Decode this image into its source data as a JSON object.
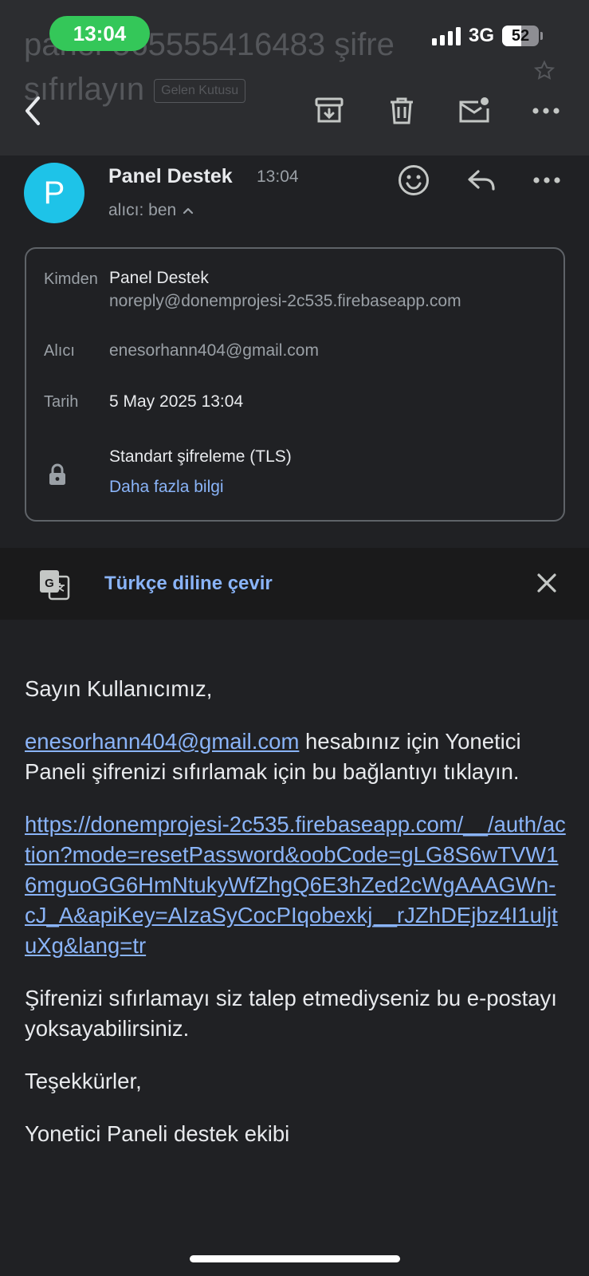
{
  "status": {
    "time": "13:04",
    "network": "3G",
    "battery": "52",
    "battery_level": 0.52
  },
  "header": {
    "subject_line1": "panel-565555416483 şifre",
    "subject_line2": "sıfırlayın",
    "label": "Gelen Kutusu"
  },
  "email": {
    "avatar_letter": "P",
    "sender_name": "Panel Destek",
    "time": "13:04",
    "to_line": "alıcı: ben"
  },
  "details": {
    "from_label": "Kimden",
    "from_name": "Panel Destek",
    "from_email": "noreply@donemprojesi-2c535.firebaseapp.com",
    "to_label": "Alıcı",
    "to_email": "enesorhann404@gmail.com",
    "date_label": "Tarih",
    "date_value": "5 May 2025 13:04",
    "encryption": "Standart şifreleme (TLS)",
    "more_info": "Daha fazla bilgi"
  },
  "translate": {
    "label": "Türkçe diline çevir"
  },
  "body": {
    "greeting": "Sayın Kullanıcımız,",
    "account_link": "enesorhann404@gmail.com",
    "intro_rest": " hesabınız için Yonetici Paneli şifrenizi sıfırlamak için bu bağlantıyı tıklayın.",
    "reset_link": "https://donemprojesi-2c535.firebaseapp.com/__/auth/action?mode=resetPassword&oobCode=gLG8S6wTVW16mguoGG6HmNtukyWfZhgQ6E3hZed2cWgAAAGWn-cJ_A&apiKey=AIzaSyCocPIqobexkj__rJZhDEjbz4I1uljtuXg&lang=tr",
    "ignore_note": "Şifrenizi sıfırlamayı siz talep etmediyseniz bu e-postayı yoksayabilirsiniz.",
    "thanks": "Teşekkürler,",
    "signature": "Yonetici Paneli destek ekibi"
  },
  "icons": {
    "back": "arrow-left-icon",
    "archive": "archive-icon",
    "delete": "trash-icon",
    "mark_unread": "mail-dot-icon",
    "more": "more-horizontal-icon",
    "emoji": "emoji-reaction-icon",
    "reply": "reply-icon",
    "lock": "lock-icon",
    "translate": "translate-icon",
    "close": "close-icon"
  },
  "colors": {
    "accent_link": "#8ab4f8",
    "avatar": "#1ec3e8",
    "status_time_pill": "#34c759",
    "background": "#202124"
  }
}
